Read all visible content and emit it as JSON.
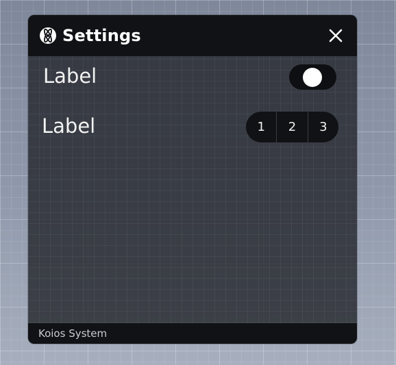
{
  "window": {
    "title": "Settings",
    "logo_icon": "atom-logo-icon",
    "close_icon": "close-icon"
  },
  "settings": [
    {
      "label": "Label",
      "control": "toggle",
      "toggle_on": true
    },
    {
      "label": "Label",
      "control": "segmented",
      "options": [
        "1",
        "2",
        "3"
      ]
    }
  ],
  "footer": {
    "text": "Koios System"
  },
  "colors": {
    "titlebar": "#111215",
    "panel": "#26292f",
    "text": "#ffffff",
    "control_bg": "#0e0f12"
  }
}
